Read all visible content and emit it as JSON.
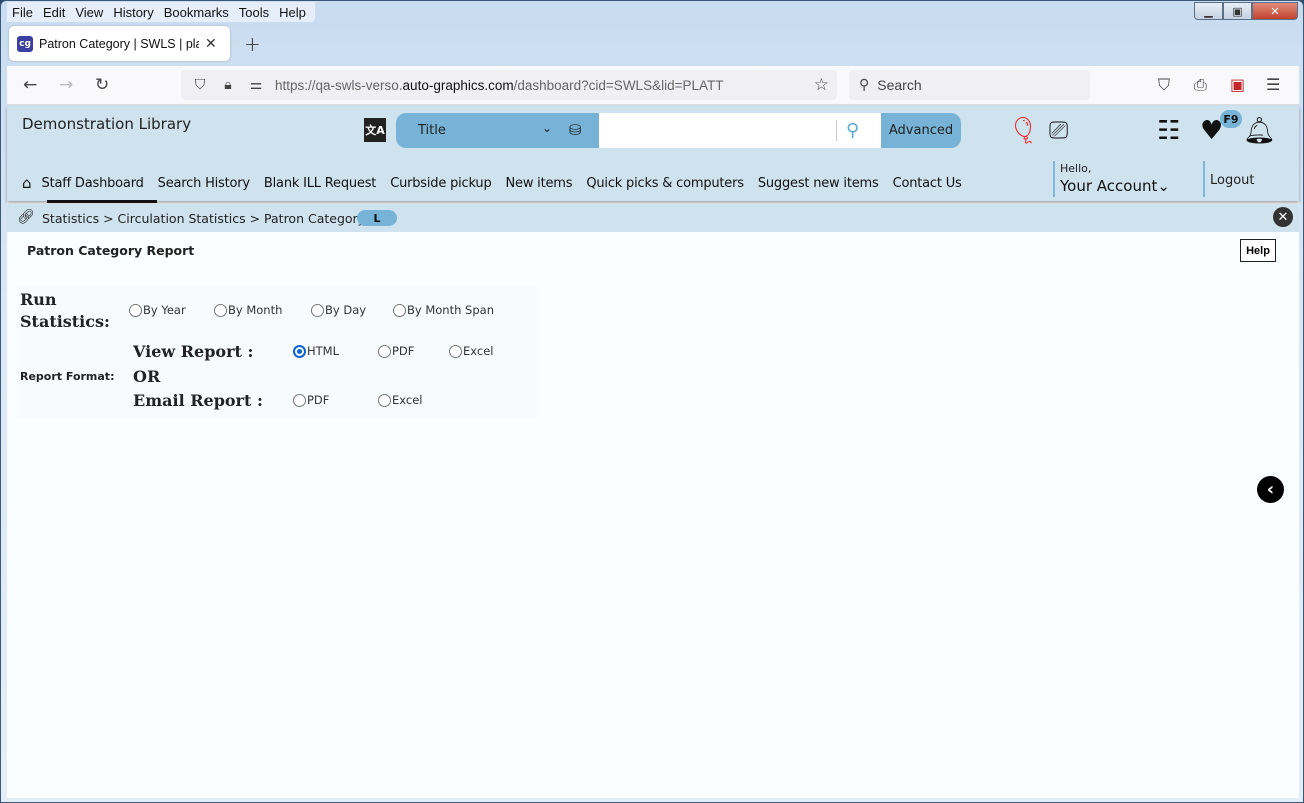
{
  "browser": {
    "menu": [
      "File",
      "Edit",
      "View",
      "History",
      "Bookmarks",
      "Tools",
      "Help"
    ],
    "tab_title": "Patron Category | SWLS | platt | A",
    "favicon_text": "cg",
    "url_prefix": "https://qa-swls-verso.",
    "url_domain": "auto-graphics.com",
    "url_suffix": "/dashboard?cid=SWLS&lid=PLATT",
    "search_placeholder": "Search"
  },
  "header": {
    "library_name": "Demonstration Library",
    "search_type": "Title",
    "search_value": "",
    "advanced_label": "Advanced",
    "badge": "F9",
    "hello": "Hello,",
    "account": "Your Account",
    "logout": "Logout"
  },
  "nav": {
    "items": [
      "Staff Dashboard",
      "Search History",
      "Blank ILL Request",
      "Curbside pickup",
      "New items",
      "Quick picks & computers",
      "Suggest new items",
      "Contact Us"
    ],
    "active": "Staff Dashboard"
  },
  "breadcrumb": {
    "text": "Statistics > Circulation Statistics > Patron Category",
    "pill": "L"
  },
  "page": {
    "title": "Patron Category Report",
    "help_label": "Help"
  },
  "form": {
    "run_label": "Run Statistics:",
    "run_options": [
      "By Year",
      "By Month",
      "By Day",
      "By Month Span"
    ],
    "run_selected": null,
    "format_label": "Report Format:",
    "view_label": "View Report :",
    "view_options": [
      "HTML",
      "PDF",
      "Excel"
    ],
    "view_selected": "HTML",
    "or_label": "OR",
    "email_label": "Email Report :",
    "email_options": [
      "PDF",
      "Excel"
    ],
    "email_selected": null
  }
}
